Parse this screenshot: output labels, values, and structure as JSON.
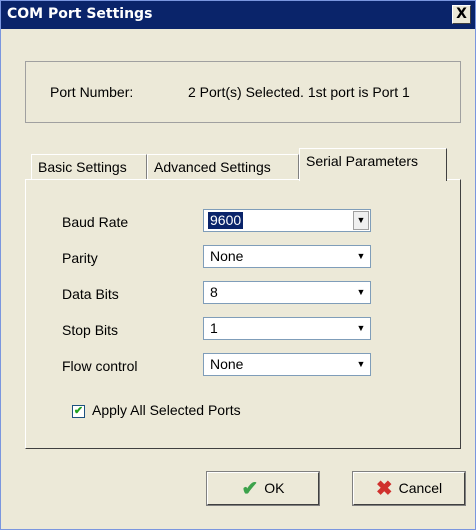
{
  "window": {
    "title": "COM Port Settings",
    "close_glyph": "X"
  },
  "port": {
    "label": "Port Number:",
    "value": "2 Port(s) Selected. 1st port is Port 1"
  },
  "tabs": [
    {
      "label": "Basic Settings",
      "active": false
    },
    {
      "label": "Advanced Settings",
      "active": false
    },
    {
      "label": "Serial Parameters",
      "active": true
    }
  ],
  "fields": [
    {
      "label": "Baud Rate",
      "value": "9600",
      "focused": true
    },
    {
      "label": "Parity",
      "value": "None"
    },
    {
      "label": "Data Bits",
      "value": "8"
    },
    {
      "label": "Stop Bits",
      "value": "1"
    },
    {
      "label": "Flow control",
      "value": "None"
    }
  ],
  "apply_all": {
    "label": "Apply All Selected Ports",
    "checked": true
  },
  "buttons": {
    "ok": "OK",
    "cancel": "Cancel"
  },
  "colors": {
    "title_bar": "#0A246A",
    "face": "#ECE9D8",
    "selection": "#0A246A"
  },
  "icons": {
    "close": "close-icon",
    "ok": "checkmark-icon",
    "cancel": "x-icon",
    "dropdown": "dropdown-arrow-icon"
  }
}
